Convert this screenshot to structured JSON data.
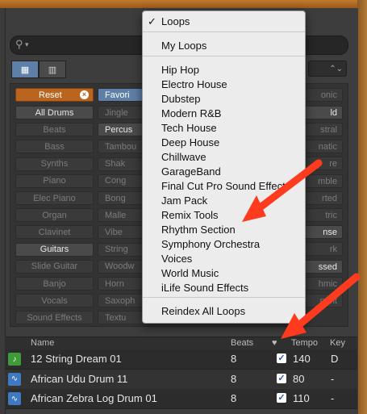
{
  "search": {
    "icon": "magnifier-icon",
    "placeholder": "",
    "caret": "▾"
  },
  "view_buttons": [
    "grid-view-icon",
    "column-view-icon"
  ],
  "dropdown": {
    "value": "⌃⌄"
  },
  "keywords": {
    "reset": "Reset",
    "favorites": "Favori",
    "col1": [
      "All Drums",
      "Beats",
      "Bass",
      "Synths",
      "Piano",
      "Elec Piano",
      "Organ",
      "Clavinet",
      "Guitars",
      "Slide Guitar",
      "Banjo",
      "Vocals",
      "Sound Effects"
    ],
    "col2": [
      "Jingle",
      "Percus",
      "Tambou",
      "Shak",
      "Cong",
      "Bong",
      "Malle",
      "Vibe",
      "String",
      "Woodw",
      "Horn",
      "Saxoph",
      "Textu"
    ],
    "col3": [
      "onic",
      "ld",
      "stral",
      "natic",
      "re",
      "mble",
      "rted",
      "tric",
      "nse",
      "rk",
      "ssed",
      "hmic",
      "nant",
      "..."
    ]
  },
  "menu": {
    "checked": "Loops",
    "my_loops": "My Loops",
    "items": [
      "Hip Hop",
      "Electro House",
      "Dubstep",
      "Modern R&B",
      "Tech House",
      "Deep House",
      "Chillwave",
      "GarageBand",
      "Final Cut Pro Sound Effects",
      "Jam Pack",
      "Remix Tools",
      "Rhythm Section",
      "Symphony Orchestra",
      "Voices",
      "World Music",
      "iLife Sound Effects"
    ],
    "reindex": "Reindex All Loops"
  },
  "table": {
    "headers": {
      "name": "Name",
      "beats": "Beats",
      "fav": "♥",
      "tempo": "Tempo",
      "key": "Key"
    },
    "rows": [
      {
        "name": "12 String Dream 01",
        "beats": "8",
        "tempo": "140",
        "key": "D",
        "icon": "green"
      },
      {
        "name": "African Udu Drum 11",
        "beats": "8",
        "tempo": "80",
        "key": "-",
        "icon": "blue"
      },
      {
        "name": "African Zebra Log Drum 01",
        "beats": "8",
        "tempo": "110",
        "key": "-",
        "icon": "blue"
      }
    ]
  },
  "colors": {
    "accent": "#5d7fa8",
    "reset": "#b9651f",
    "arrow": "#ff3b1f"
  }
}
